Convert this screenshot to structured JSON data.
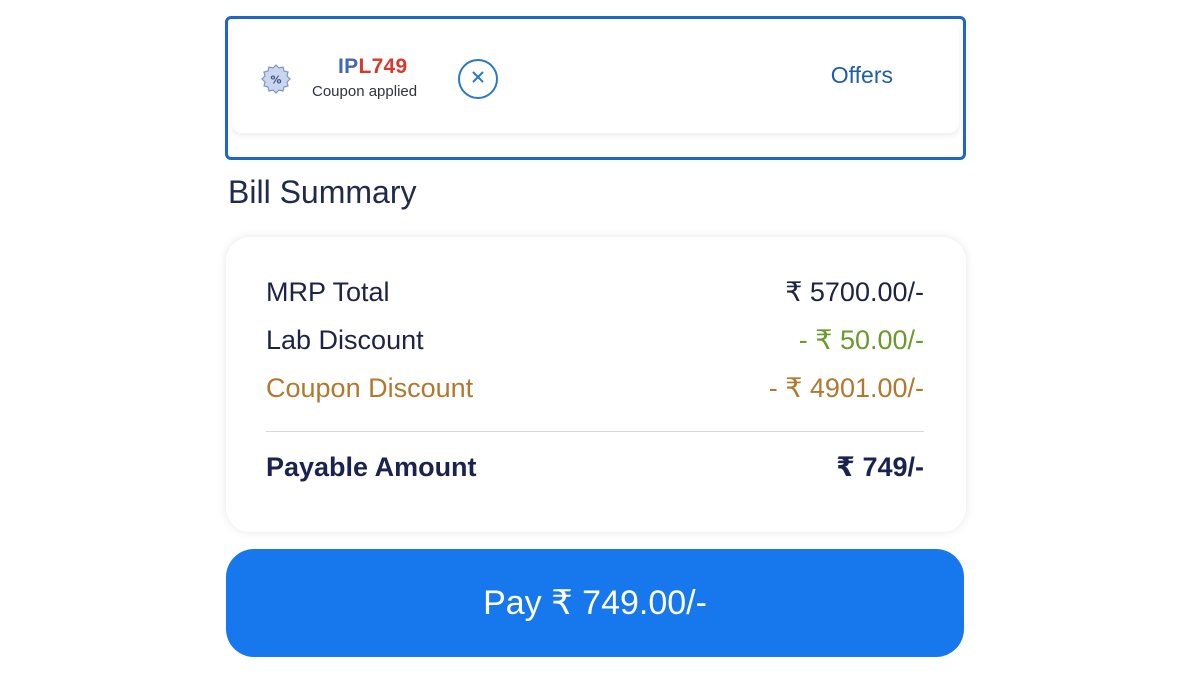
{
  "coupon": {
    "badge_icon": "percent-badge-icon",
    "code_prefix": "IP",
    "code_suffix": "L749",
    "status": "Coupon applied",
    "remove_icon": "close-icon",
    "offers_label": "Offers",
    "colors": {
      "border": "#1e66c8",
      "code_prefix": "#4466b8",
      "code_suffix": "#d9382c",
      "offers": "#1f5ea8"
    }
  },
  "bill": {
    "title": "Bill Summary",
    "rows": [
      {
        "label": "MRP Total",
        "value": "₹ 5700.00/-"
      },
      {
        "label": "Lab Discount",
        "value": "- ₹ 50.00/-"
      },
      {
        "label": "Coupon Discount",
        "value": "- ₹ 4901.00/-"
      }
    ],
    "payable": {
      "label": "Payable Amount",
      "value": "₹ 749/-"
    },
    "colors": {
      "lab_discount_value": "#6a9a2a",
      "coupon_discount": "#b2782e"
    }
  },
  "pay_button": {
    "label": "Pay ₹ 749.00/-",
    "color": "#1678ec"
  }
}
